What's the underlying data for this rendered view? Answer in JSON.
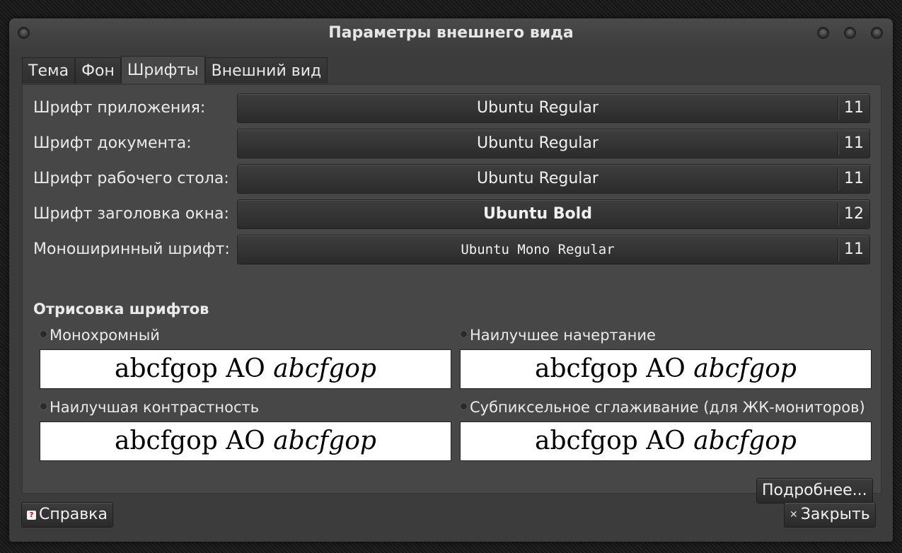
{
  "window": {
    "title": "Параметры внешнего вида"
  },
  "tabs": [
    {
      "label": "Тема"
    },
    {
      "label": "Фон"
    },
    {
      "label": "Шрифты"
    },
    {
      "label": "Внешний вид"
    }
  ],
  "fonts": [
    {
      "label": "Шрифт приложения:",
      "name": "Ubuntu Regular",
      "size": "11"
    },
    {
      "label": "Шрифт документа:",
      "name": "Ubuntu Regular",
      "size": "11"
    },
    {
      "label": "Шрифт рабочего стола:",
      "name": "Ubuntu Regular",
      "size": "11"
    },
    {
      "label": "Шрифт заголовка окна:",
      "name": "Ubuntu Bold",
      "size": "12"
    },
    {
      "label": "Моноширинный шрифт:",
      "name": "Ubuntu Mono Regular",
      "size": "11"
    }
  ],
  "rendering": {
    "title": "Отрисовка шрифтов",
    "preview_normal": "abcfgop AO",
    "preview_italic": "abcfgop",
    "options": [
      {
        "label": "Монохромный"
      },
      {
        "label": "Наилучшее начертание"
      },
      {
        "label": "Наилучшая контрастность"
      },
      {
        "label": "Субпиксельное сглаживание (для ЖК-мониторов)"
      }
    ],
    "details_label": "Подробнее..."
  },
  "footer": {
    "help_label": "Справка",
    "close_label": "Закрыть"
  },
  "colors": {
    "window_bg": "#3c3c3c",
    "panel_bg": "#474747",
    "text": "#eaeaea",
    "preview_bg": "#ffffff"
  }
}
